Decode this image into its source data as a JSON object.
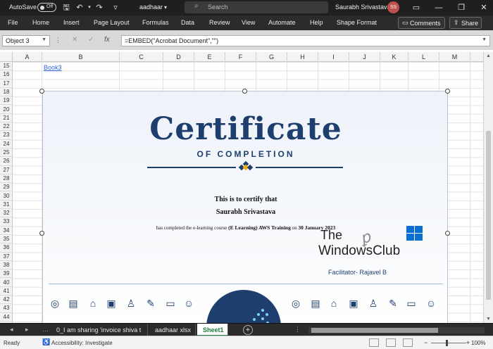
{
  "titlebar": {
    "autosave_label": "AutoSave",
    "autosave_state": "Off",
    "file_name": "aadhaar",
    "search_placeholder": "Search",
    "user_name": "Saurabh Srivastava",
    "user_initials": "SS"
  },
  "menu": {
    "items": [
      "File",
      "Home",
      "Insert",
      "Page Layout",
      "Formulas",
      "Data",
      "Review",
      "View",
      "Automate",
      "Help",
      "Shape Format"
    ],
    "comments_label": "Comments",
    "share_label": "Share"
  },
  "formula_bar": {
    "name_box": "Object 3",
    "formula": "=EMBED(\"Acrobat Document\",\"\")"
  },
  "grid": {
    "columns": [
      "A",
      "B",
      "C",
      "D",
      "E",
      "F",
      "G",
      "H",
      "I",
      "J",
      "K",
      "L",
      "M"
    ],
    "rows": [
      "15",
      "16",
      "17",
      "18",
      "19",
      "20",
      "21",
      "22",
      "23",
      "24",
      "25",
      "26",
      "27",
      "28",
      "29",
      "30",
      "31",
      "32",
      "33",
      "34",
      "35",
      "36",
      "37",
      "38",
      "39",
      "40",
      "41",
      "42",
      "43",
      "44"
    ],
    "link_text": "Book3"
  },
  "certificate": {
    "title": "Certificate",
    "subtitle": "OF COMPLETION",
    "line1": "This is to certify that",
    "recipient": "Saurabh Srivastava",
    "course_prefix": "has completed the e-learning course",
    "course_name": "(E Learning) AWS Training",
    "course_mid": "on",
    "course_date": "30 January 2023",
    "facilitator": "Facilitator- Rajavel B",
    "brand_color": "#1e3f6e"
  },
  "watermark": {
    "line1": "The",
    "line2": "WindowsClub"
  },
  "sheet_tabs": {
    "tabs": [
      "0_I am sharing 'invoice shiva t",
      "aadhaar xlsx",
      "Sheet1"
    ],
    "active": "Sheet1"
  },
  "status": {
    "ready": "Ready",
    "accessibility": "Accessibility: Investigate",
    "zoom": "100%"
  }
}
